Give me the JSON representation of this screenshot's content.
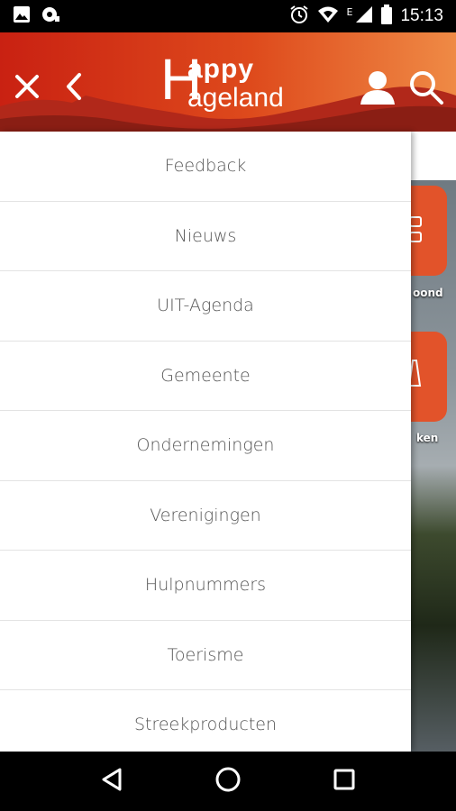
{
  "status_bar": {
    "time": "15:13",
    "network_label": "E",
    "icons": [
      "image-icon",
      "location-icon",
      "alarm-icon",
      "wifi-icon",
      "signal-icon",
      "battery-icon"
    ]
  },
  "header": {
    "logo_line1": "appy",
    "logo_line2": "ageland",
    "logo_initial": "H",
    "colors": {
      "start": "#c92112",
      "end": "#ef8a45",
      "hills": "#8a1e14"
    }
  },
  "background": {
    "tiles": [
      {
        "label": "oond"
      },
      {
        "label": "ken"
      }
    ]
  },
  "menu": {
    "items": [
      {
        "label": "Feedback"
      },
      {
        "label": "Nieuws"
      },
      {
        "label": "UIT-Agenda"
      },
      {
        "label": "Gemeente"
      },
      {
        "label": "Ondernemingen"
      },
      {
        "label": "Verenigingen"
      },
      {
        "label": "Hulpnummers"
      },
      {
        "label": "Toerisme"
      },
      {
        "label": "Streekproducten"
      }
    ]
  }
}
